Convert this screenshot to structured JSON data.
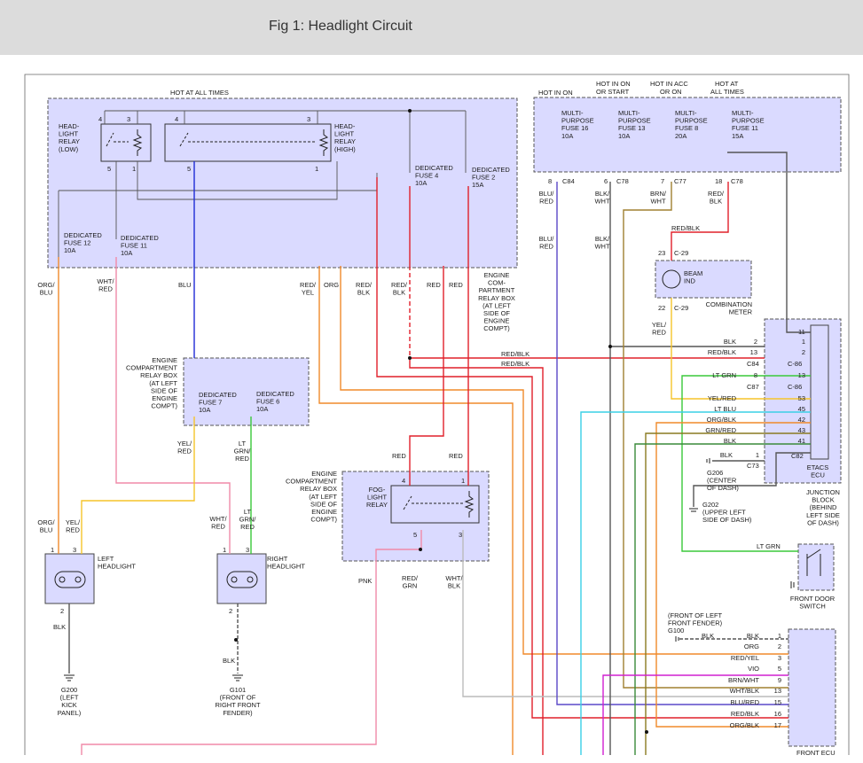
{
  "header": {
    "title": "Fig 1: Headlight Circuit"
  },
  "colors": {
    "box_fill": "#dadaff",
    "box_border": "#444444",
    "wire_gray": "#555555",
    "wire_blue": "#1f2bd6",
    "wire_red": "#e0202a",
    "wire_orange": "#f08a2a",
    "wire_pink": "#f08aa8",
    "wire_yellow": "#f6c42a",
    "wire_green": "#3ac93a",
    "wire_cyan": "#3ad0e6",
    "wire_purple": "#5a48c8",
    "wire_olive": "#a08030",
    "wire_magenta": "#d020d0",
    "wire_brown": "#8a5a30"
  },
  "labels": {
    "hot_at_all_times_top": "HOT AT ALL TIMES",
    "hot_in_on": "HOT IN ON",
    "hot_in_on_start_1": "HOT IN ON",
    "hot_in_on_start_2": "OR START",
    "hot_in_acc_1": "HOT IN ACC",
    "hot_in_acc_2": "OR ON",
    "hot_at_1": "HOT AT",
    "hot_at_2": "ALL TIMES",
    "hl_relay_low": [
      "HEAD-",
      "LIGHT",
      "RELAY",
      "(LOW)"
    ],
    "hl_relay_high": [
      "HEAD-",
      "LIGHT",
      "RELAY",
      "(HIGH)"
    ],
    "ded_fuse_4": [
      "DEDICATED",
      "FUSE 4",
      "10A"
    ],
    "ded_fuse_2": [
      "DEDICATED",
      "FUSE 2",
      "15A"
    ],
    "ded_fuse_12": [
      "DEDICATED",
      "FUSE 12",
      "10A"
    ],
    "ded_fuse_11": [
      "DEDICATED",
      "FUSE 11",
      "10A"
    ],
    "mp_fuse_16": [
      "MULTI-",
      "PURPOSE",
      "FUSE 16",
      "10A"
    ],
    "mp_fuse_13": [
      "MULTI-",
      "PURPOSE",
      "FUSE 13",
      "10A"
    ],
    "mp_fuse_8": [
      "MULTI-",
      "PURPOSE",
      "FUSE 8",
      "20A"
    ],
    "mp_fuse_11": [
      "MULTI-",
      "PURPOSE",
      "FUSE 11",
      "15A"
    ],
    "eng_comp_relay_box_1": [
      "ENGINE",
      "COM-",
      "PARTMENT",
      "RELAY BOX",
      "(AT LEFT",
      "SIDE OF",
      "ENGINE",
      "COMPT)"
    ],
    "eng_comp_relay_box_2": [
      "ENGINE",
      "COMPARTMENT",
      "RELAY BOX",
      "(AT LEFT",
      "SIDE OF",
      "ENGINE",
      "COMPT)"
    ],
    "eng_comp_relay_box_3": [
      "ENGINE",
      "COMPARTMENT",
      "RELAY BOX",
      "(AT LEFT",
      "SIDE OF",
      "ENGINE",
      "COMPT)"
    ],
    "ded_fuse_7": [
      "DEDICATED",
      "FUSE 7",
      "10A"
    ],
    "ded_fuse_6": [
      "DEDICATED",
      "FUSE 6",
      "10A"
    ],
    "fog_light_relay": [
      "FOG-",
      "LIGHT",
      "RELAY"
    ],
    "beam_ind": [
      "BEAM",
      "IND"
    ],
    "combination_meter": [
      "COMBINATION",
      "METER"
    ],
    "etacs_ecu": [
      "ETACS",
      "ECU"
    ],
    "junction_block": [
      "JUNCTION",
      "BLOCK",
      "(BEHIND",
      "LEFT SIDE",
      "OF DASH)"
    ],
    "g206": [
      "G206",
      "(CENTER",
      "OF DASH)"
    ],
    "g202": [
      "G202",
      "(UPPER LEFT",
      "SIDE OF DASH)"
    ],
    "front_door_switch": [
      "FRONT DOOR",
      "SWITCH"
    ],
    "left_headlight": [
      "LEFT",
      "HEADLIGHT"
    ],
    "right_headlight": [
      "RIGHT",
      "HEADLIGHT"
    ],
    "g200": [
      "G200",
      "(LEFT",
      "KICK",
      "PANEL)"
    ],
    "g101": [
      "G101",
      "(FRONT OF",
      "RIGHT FRONT",
      "FENDER)"
    ],
    "g100": [
      "(FRONT OF LEFT",
      "FRONT FENDER)",
      "G100"
    ],
    "front_ecu": "FRONT ECU"
  },
  "wire_labels": {
    "org_blu": [
      "ORG/",
      "BLU"
    ],
    "wht_red": [
      "WHT/",
      "RED"
    ],
    "blu": "BLU",
    "red_yel": [
      "RED/",
      "YEL"
    ],
    "org": "ORG",
    "red_blk": [
      "RED/",
      "BLK"
    ],
    "red": "RED",
    "yel_red": [
      "YEL/",
      "RED"
    ],
    "lt_grn_red": [
      "LT",
      "GRN/",
      "RED"
    ],
    "blk": "BLK",
    "pnk": "PNK",
    "red_grn": [
      "RED/",
      "GRN"
    ],
    "wht_blk": [
      "WHT/",
      "BLK"
    ],
    "blu_red": [
      "BLU/",
      "RED"
    ],
    "blk_wht": [
      "BLK/",
      "WHT"
    ],
    "brn_wht": [
      "BRN/",
      "WHT"
    ],
    "red_blk_2": [
      "RED/",
      "BLK"
    ],
    "red_blk_single": "RED/BLK",
    "yel_red_2": [
      "YEL/",
      "RED"
    ]
  },
  "connectors": {
    "c84": "C84",
    "c78": "C78",
    "c77": "C77",
    "c78b": "C78",
    "c29a": "C-29",
    "c29b": "C-29",
    "c84b": "C84",
    "c86a": "C-86",
    "c87": "C87",
    "c86b": "C-86",
    "c73": "C73",
    "c82": "C82"
  },
  "etacs_rows": [
    {
      "label": "BLK",
      "pin_left": "2",
      "pin_right": "1"
    },
    {
      "label": "RED/BLK",
      "pin_left": "13",
      "pin_right": "2"
    },
    {
      "label": "LT GRN",
      "pin_left": "8",
      "pin_right": "13"
    },
    {
      "label": "YEL/RED",
      "pin_left": "",
      "pin_right": "53"
    },
    {
      "label": "LT BLU",
      "pin_left": "",
      "pin_right": "45"
    },
    {
      "label": "ORG/BLK",
      "pin_left": "",
      "pin_right": "42"
    },
    {
      "label": "GRN/RED",
      "pin_left": "",
      "pin_right": "43"
    },
    {
      "label": "BLK",
      "pin_left": "",
      "pin_right": "41"
    },
    {
      "label": "BLK",
      "pin_left": "1",
      "pin_right": ""
    }
  ],
  "front_ecu_rows": [
    {
      "label": "BLK",
      "pin": "1"
    },
    {
      "label": "ORG",
      "pin": "2"
    },
    {
      "label": "RED/YEL",
      "pin": "3"
    },
    {
      "label": "VIO",
      "pin": "5"
    },
    {
      "label": "BRN/WHT",
      "pin": "9"
    },
    {
      "label": "WHT/BLK",
      "pin": "13"
    },
    {
      "label": "BLU/RED",
      "pin": "15"
    },
    {
      "label": "RED/BLK",
      "pin": "16"
    },
    {
      "label": "ORG/BLK",
      "pin": "17"
    }
  ],
  "pins": {
    "p4a": "4",
    "p3a": "3",
    "p5a": "5",
    "p1a": "1",
    "p4b": "4",
    "p3b": "3",
    "p5b": "5",
    "p1b": "1",
    "p8": "8",
    "p6": "6",
    "p7": "7",
    "p18": "18",
    "p23": "23",
    "p22": "22",
    "p11": "11",
    "fog4": "4",
    "fog1": "1",
    "fog5": "5",
    "fog3": "3",
    "lh1": "1",
    "lh3": "3",
    "lh2": "2",
    "rh1": "1",
    "rh3": "3",
    "rh2": "2"
  },
  "wire_text": {
    "etacs_row1_lt_grn": "LT GRN",
    "etacs_red_blk_1": "RED/BLK",
    "etacs_red_blk_2": "RED/BLK",
    "g100_blk": "BLK"
  }
}
